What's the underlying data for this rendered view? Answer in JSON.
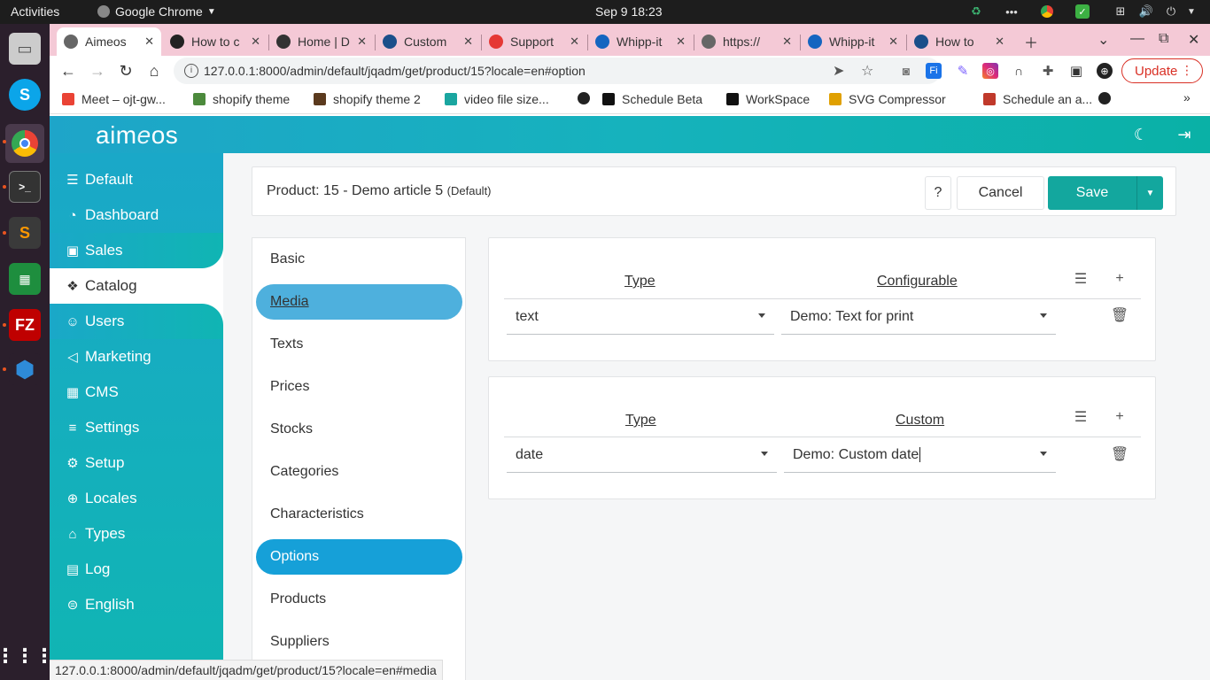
{
  "os": {
    "activities": "Activities",
    "app_menu": "Google Chrome",
    "clock": "Sep 9  18:23"
  },
  "browser": {
    "tabs": [
      {
        "label": "Aimeos",
        "icon": "globe-icon",
        "active": true
      },
      {
        "label": "How to c",
        "icon": "github-icon"
      },
      {
        "label": "Home | D",
        "icon": "dev-icon"
      },
      {
        "label": "Custom",
        "icon": "site-icon"
      },
      {
        "label": "Support",
        "icon": "support-icon"
      },
      {
        "label": "Whipp-it",
        "icon": "whipp-icon"
      },
      {
        "label": "https://",
        "icon": "globe-icon"
      },
      {
        "label": "Whipp-it",
        "icon": "whipp-icon"
      },
      {
        "label": "How to",
        "icon": "site-icon"
      }
    ],
    "url": "127.0.0.1:8000/admin/default/jqadm/get/product/15?locale=en#option",
    "update_label": "Update",
    "bookmarks": [
      {
        "label": "Meet – ojt-gw...",
        "color": "#ea4335"
      },
      {
        "label": "shopify theme",
        "color": "#4c8a3c"
      },
      {
        "label": "shopify theme 2",
        "color": "#5b3a1e"
      },
      {
        "label": "video file size...",
        "color": "#1aa6a0"
      },
      {
        "label": "",
        "color": "#222222"
      },
      {
        "label": "Schedule Beta",
        "color": "#111111"
      },
      {
        "label": "WorkSpace",
        "color": "#111111"
      },
      {
        "label": "SVG Compressor",
        "color": "#e0a000"
      },
      {
        "label": "Schedule an a...",
        "color": "#c0392b"
      },
      {
        "label": "",
        "color": "#222222"
      }
    ],
    "status_url": "127.0.0.1:8000/admin/default/jqadm/get/product/15?locale=en#media"
  },
  "app": {
    "logo_pre": "aim",
    "logo_e": "e",
    "logo_post": "os",
    "sidebar": [
      {
        "label": "Default",
        "icon": "list-icon"
      },
      {
        "label": "Dashboard",
        "icon": "dashboard-icon"
      },
      {
        "label": "Sales",
        "icon": "money-icon"
      },
      {
        "label": "Catalog",
        "icon": "catalog-icon",
        "active": true
      },
      {
        "label": "Users",
        "icon": "user-icon"
      },
      {
        "label": "Marketing",
        "icon": "megaphone-icon"
      },
      {
        "label": "CMS",
        "icon": "grid-icon"
      },
      {
        "label": "Settings",
        "icon": "sliders-icon"
      },
      {
        "label": "Setup",
        "icon": "gear-icon"
      },
      {
        "label": "Locales",
        "icon": "globe-icon"
      },
      {
        "label": "Types",
        "icon": "tag-icon"
      },
      {
        "label": "Log",
        "icon": "log-icon"
      },
      {
        "label": "English",
        "icon": "language-icon"
      }
    ],
    "product_title": "Product: 15 - Demo article 5",
    "product_site": "(Default)",
    "help_label": "?",
    "cancel_label": "Cancel",
    "save_label": "Save",
    "sections": [
      {
        "label": "Basic"
      },
      {
        "label": "Media",
        "state": "hover"
      },
      {
        "label": "Texts"
      },
      {
        "label": "Prices"
      },
      {
        "label": "Stocks"
      },
      {
        "label": "Categories"
      },
      {
        "label": "Characteristics"
      },
      {
        "label": "Options",
        "state": "active"
      },
      {
        "label": "Products"
      },
      {
        "label": "Suppliers"
      }
    ],
    "configurable": {
      "col_type": "Type",
      "col_value": "Configurable",
      "type_value": "text",
      "attr_value": "Demo: Text for print"
    },
    "custom": {
      "col_type": "Type",
      "col_value": "Custom",
      "type_value": "date",
      "attr_value": "Demo: Custom date"
    }
  },
  "colors": {
    "accent": "#13a79e",
    "active_tab": "#16a0d8",
    "sidebar_start": "#1aa8c8",
    "sidebar_end": "#10b5b3",
    "tabstrip": "#f4c9d6"
  }
}
